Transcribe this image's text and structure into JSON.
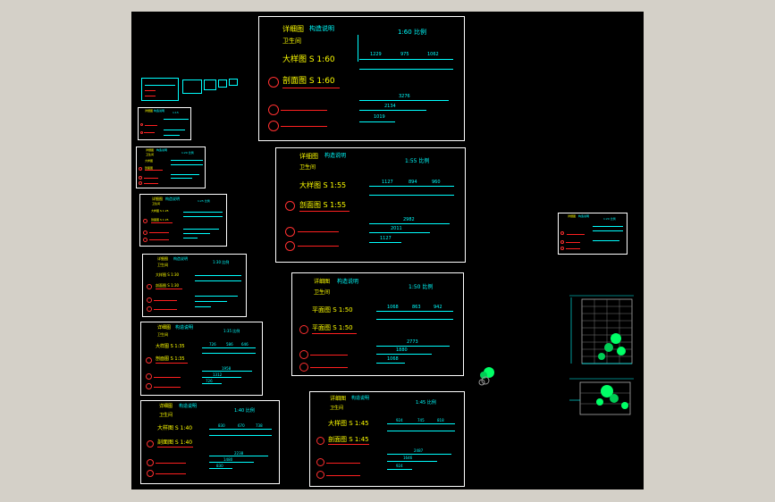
{
  "sheets": {
    "s60": {
      "title": "详细图",
      "sub": "构造说明",
      "room": "卫生间",
      "scale": "1:60 比例",
      "view1": "大样图 S 1:60",
      "view2": "剖面图 S 1:60",
      "dims": [
        "1229",
        "975",
        "1062"
      ],
      "dims2": [
        "3276",
        "2134",
        "1019"
      ]
    },
    "s55": {
      "title": "详细图",
      "sub": "构造说明",
      "room": "卫生间",
      "scale": "1:55 比例",
      "view1": "大样图 S 1:55",
      "view2": "剖面图 S 1:55",
      "dims": [
        "1127",
        "894",
        "960"
      ],
      "dims2": [
        "2982",
        "2011",
        "1127"
      ]
    },
    "s50": {
      "title": "详细图",
      "sub": "构造说明",
      "room": "卫生间",
      "scale": "1:50 比例",
      "view1": "平面图 S 1:50",
      "view2": "平面图 S 1:50",
      "dims": [
        "1068",
        "863",
        "942"
      ],
      "dims2": [
        "2773",
        "1880",
        "1068"
      ]
    },
    "s45": {
      "title": "详细图",
      "sub": "构造说明",
      "room": "卫生间",
      "scale": "1:45 比例",
      "view1": "大样图 S 1:45",
      "view2": "剖面图 S 1:45",
      "dims": [
        "924",
        "745",
        "818"
      ],
      "dims2": [
        "2487",
        "1646",
        "924"
      ]
    },
    "s40": {
      "title": "详细图",
      "sub": "构造说明",
      "room": "卫生间",
      "scale": "1:40 比例",
      "view1": "大样图 S 1:40",
      "view2": "剖面图 S 1:40",
      "dims": [
        "830",
        "670",
        "738"
      ],
      "dims2": [
        "2238",
        "1480",
        "830"
      ]
    },
    "s35": {
      "title": "详细图",
      "sub": "构造说明",
      "room": "卫生间",
      "scale": "1:35 比例",
      "view1": "大样图 S 1:35",
      "view2": "剖面图 S 1:35",
      "dims": [
        "726",
        "586",
        "646"
      ],
      "dims2": [
        "1958",
        "1312",
        "726"
      ]
    },
    "s30": {
      "title": "详细图",
      "sub": "构造说明",
      "room": "卫生间",
      "scale": "1:30 比例",
      "view1": "大样图 S 1:30",
      "view2": "剖面图 S 1:30"
    },
    "s25": {
      "title": "详细图",
      "sub": "构造说明",
      "room": "卫生间",
      "scale": "1:25 比例",
      "view1": "大样图 S 1:25",
      "view2": "剖面图 S 1:25"
    },
    "s20": {
      "title": "详细图",
      "sub": "构造说明",
      "room": "卫生间",
      "scale": "1:20 比例",
      "view1": "大样图",
      "view2": "剖面图"
    },
    "s15": {
      "title": "详细图",
      "sub": "构造说明",
      "scale": "1:15"
    },
    "right": {
      "title": "详细图",
      "sub": "构造说明",
      "scale": "1:20 比例"
    }
  },
  "colors": {
    "line": "#00ffff",
    "label": "#ffff00",
    "mark": "#ff3030",
    "frame": "#ffffff",
    "plant": "#00ff66"
  }
}
